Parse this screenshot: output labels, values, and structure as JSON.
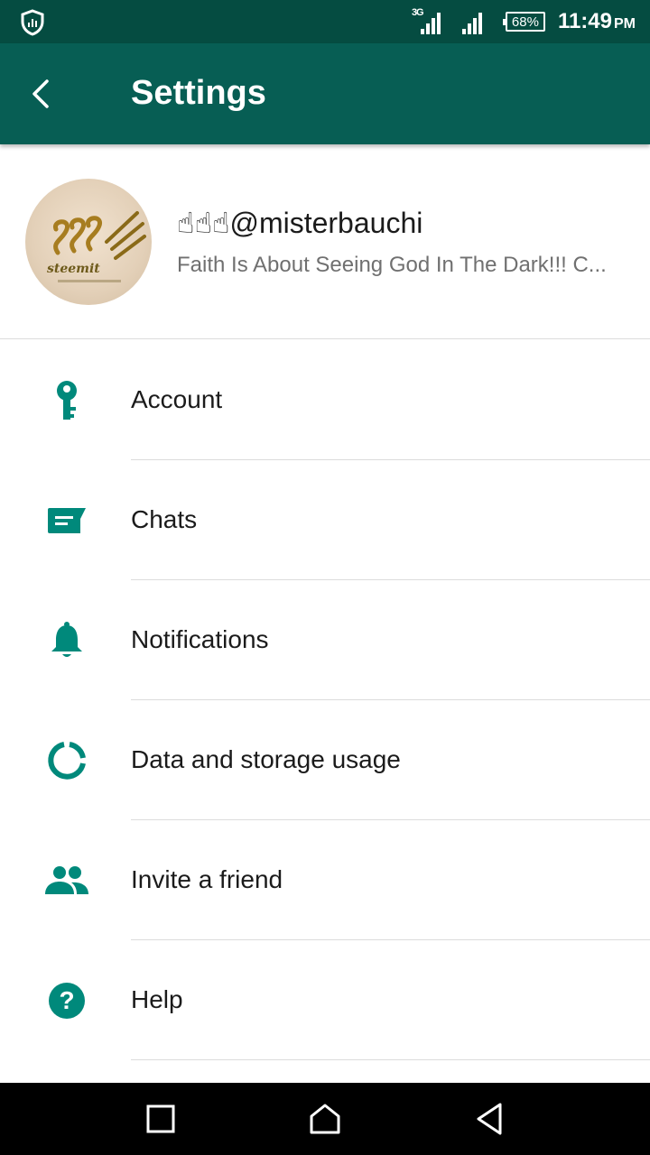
{
  "status_bar": {
    "network_type": "3G",
    "battery_percent": "68%",
    "time": "11:49",
    "ampm": "PM",
    "icons": [
      "shield-icon",
      "signal-icon",
      "signal-icon",
      "battery-icon"
    ]
  },
  "app_bar": {
    "title": "Settings",
    "back_icon": "back-arrow-icon"
  },
  "profile": {
    "name": "☝☝☝@misterbauchi",
    "status": "Faith Is About Seeing God In The Dark!!! C...",
    "avatar_text": "steemit"
  },
  "menu": {
    "items": [
      {
        "label": "Account",
        "icon": "key-icon"
      },
      {
        "label": "Chats",
        "icon": "chat-icon"
      },
      {
        "label": "Notifications",
        "icon": "bell-icon"
      },
      {
        "label": "Data and storage usage",
        "icon": "data-usage-icon"
      },
      {
        "label": "Invite a friend",
        "icon": "people-icon"
      },
      {
        "label": "Help",
        "icon": "help-icon"
      }
    ]
  },
  "nav_bar": {
    "icons": [
      "recents-icon",
      "home-icon",
      "back-icon"
    ]
  },
  "colors": {
    "status_bar": "#054c41",
    "app_bar": "#075e54",
    "accent": "#00897b"
  }
}
